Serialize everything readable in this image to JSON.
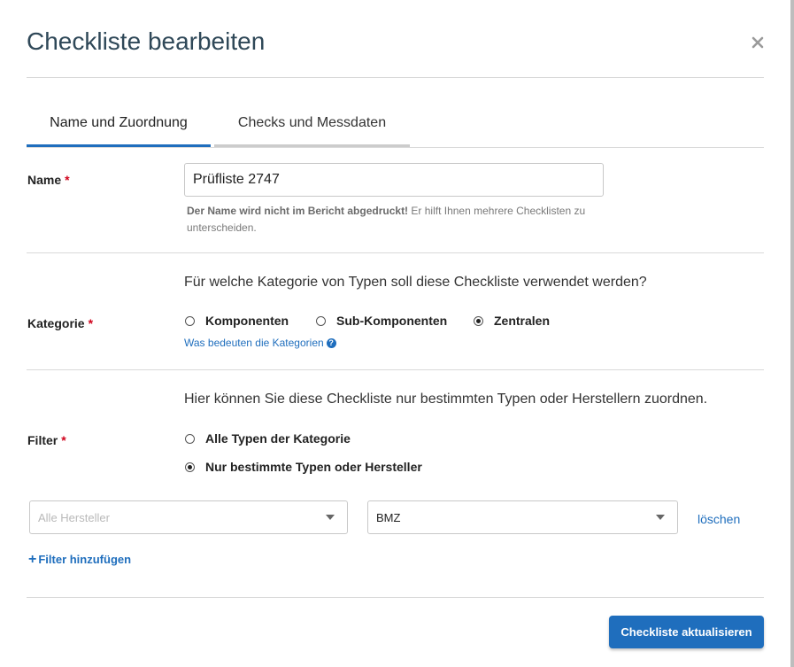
{
  "dialog": {
    "title": "Checkliste bearbeiten",
    "close_icon": "close-icon"
  },
  "tabs": [
    {
      "label": "Name und Zuordnung",
      "active": true
    },
    {
      "label": "Checks und Messdaten",
      "active": false
    }
  ],
  "name_section": {
    "label": "Name",
    "required_mark": "*",
    "value": "Prüfliste 2747",
    "hint_bold": "Der Name wird nicht im Bericht abgedruckt!",
    "hint_text": " Er hilft Ihnen mehrere Checklisten zu unterscheiden."
  },
  "category_section": {
    "label": "Kategorie",
    "required_mark": "*",
    "question": "Für welche Kategorie von Typen soll diese Checkliste verwendet werden?",
    "options": [
      {
        "label": "Komponenten",
        "selected": false
      },
      {
        "label": "Sub-Komponenten",
        "selected": false
      },
      {
        "label": "Zentralen",
        "selected": true
      }
    ],
    "help_link": "Was bedeuten die Kategorien",
    "help_icon": "question-circle-icon"
  },
  "filter_section": {
    "label": "Filter",
    "required_mark": "*",
    "question": "Hier können Sie diese Checkliste nur bestimmten Typen oder Herstellern zuordnen.",
    "options": [
      {
        "label": "Alle Typen der Kategorie",
        "selected": false
      },
      {
        "label": "Nur bestimmte Typen oder Hersteller",
        "selected": true
      }
    ],
    "manufacturer_placeholder": "Alle Hersteller",
    "type_value": "BMZ",
    "delete_link": "löschen",
    "add_filter_icon": "plus-icon",
    "add_filter_label": "Filter hinzufügen"
  },
  "footer": {
    "submit_label": "Checkliste aktualisieren"
  },
  "colors": {
    "accent": "#1f6ebd",
    "title": "#2f4858",
    "required": "#d0021b",
    "inactive_tab_bar": "#cccccc"
  }
}
